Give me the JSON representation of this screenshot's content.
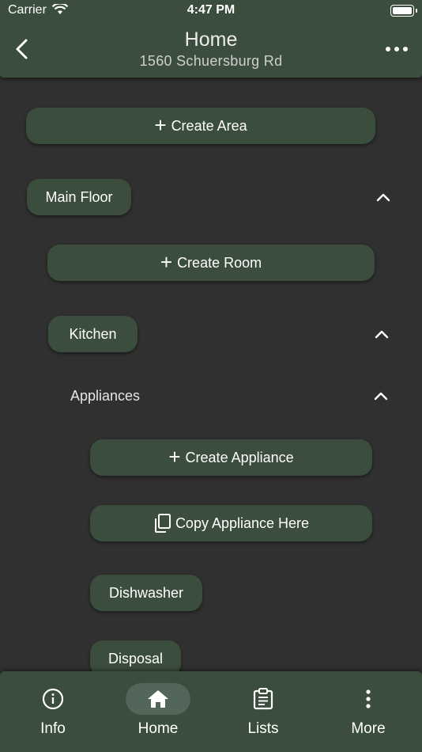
{
  "status_bar": {
    "carrier": "Carrier",
    "time": "4:47 PM"
  },
  "header": {
    "title": "Home",
    "subtitle": "1560 Schuersburg Rd"
  },
  "content": {
    "create_area_label": "Create Area",
    "area": {
      "name": "Main Floor",
      "create_room_label": "Create Room",
      "room": {
        "name": "Kitchen",
        "section_label": "Appliances",
        "create_appliance_label": "Create Appliance",
        "copy_appliance_label": "Copy Appliance Here",
        "appliances": [
          "Dishwasher",
          "Disposal"
        ]
      }
    }
  },
  "bottom_nav": [
    {
      "label": "Info",
      "icon": "info-icon",
      "active": false
    },
    {
      "label": "Home",
      "icon": "home-icon",
      "active": true
    },
    {
      "label": "Lists",
      "icon": "clipboard-icon",
      "active": false
    },
    {
      "label": "More",
      "icon": "more-vertical-icon",
      "active": false
    }
  ],
  "colors": {
    "background": "#303030",
    "surface": "#3b4d3d",
    "active_indicator": "#52665a"
  }
}
